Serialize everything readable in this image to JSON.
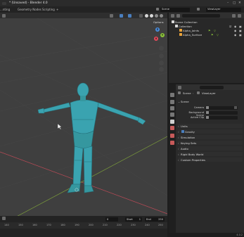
{
  "window": {
    "title": "* (Unsaved) - Blender 4.0"
  },
  "topbar": {
    "workspaces": [
      "...nting",
      "Geometry Nodes",
      "Scripting"
    ],
    "add_tab": "+",
    "scene_label": "Scene",
    "view_layer_label": "ViewLayer"
  },
  "viewport": {
    "options_label": "Options",
    "gizmo": {
      "x_label": "X",
      "y_label": "Y",
      "z_label": "Z"
    },
    "colors": {
      "x": "#e8495b",
      "y": "#8cc43a",
      "z": "#4a8fe0",
      "model": "#3aa3b0"
    }
  },
  "timeline": {
    "ruler_labels": [
      "140",
      "150",
      "160",
      "170",
      "180",
      "190",
      "200",
      "210",
      "220",
      "230",
      "240",
      "250"
    ],
    "current_frame": "0",
    "start_label": "Start",
    "start_value": "1",
    "end_label": "End",
    "end_value": "250"
  },
  "outliner": {
    "rows": [
      {
        "label": "Scene Collection"
      },
      {
        "label": "Collection"
      },
      {
        "label": "Alpha_Joints"
      },
      {
        "label": "Alpha_Surface"
      }
    ]
  },
  "properties": {
    "crumb_scene": "Scene",
    "crumb_layer": "ViewLayer",
    "scene_panel": "Scene",
    "camera_label": "Camera",
    "background_scene_label": "Background Scene",
    "active_clip_label": "Active Clip",
    "units_panel": "Units",
    "gravity_label": "Gravity",
    "simulation_panel": "Simulation",
    "keying_sets_panel": "Keying Sets",
    "audio_panel": "Audio",
    "rigid_body_world_panel": "Rigid Body World",
    "custom_properties_panel": "Custom Properties"
  },
  "status": {
    "version": "4.0.2"
  }
}
